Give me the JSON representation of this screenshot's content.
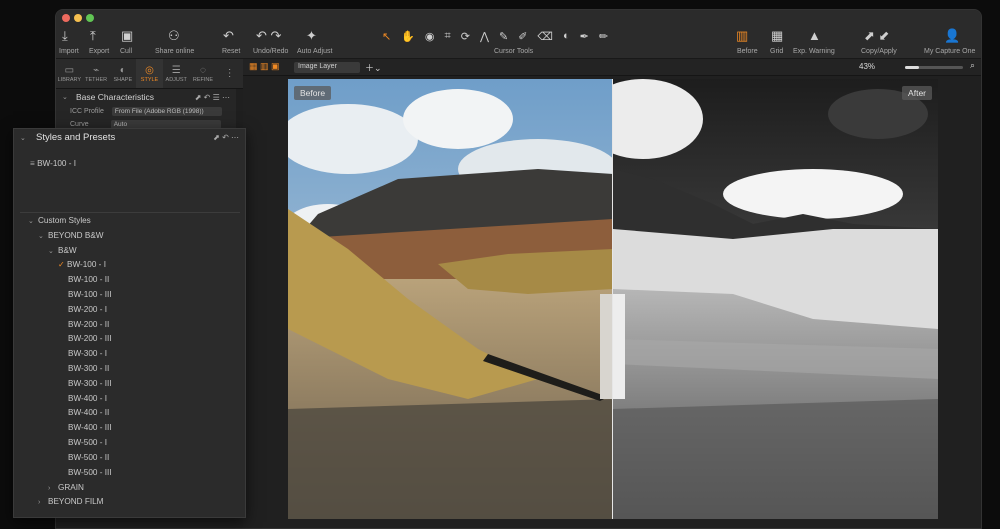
{
  "toolbar": {
    "buttons": [
      {
        "label": "Import",
        "icon": "import-icon"
      },
      {
        "label": "Export",
        "icon": "export-icon"
      },
      {
        "label": "Cull",
        "icon": "cull-icon"
      },
      {
        "label": "Share online",
        "icon": "share-online-icon"
      },
      {
        "label": "Reset",
        "icon": "reset-icon"
      },
      {
        "label": "Undo/Redo",
        "icon": "undo-redo-icon"
      },
      {
        "label": "Auto Adjust",
        "icon": "auto-adjust-icon"
      },
      {
        "label": "Before",
        "icon": "before-icon"
      },
      {
        "label": "Grid",
        "icon": "grid-icon"
      },
      {
        "label": "Exp. Warning",
        "icon": "exposure-warning-icon"
      },
      {
        "label": "Copy/Apply",
        "icon": "copy-apply-icon"
      },
      {
        "label": "My Capture One",
        "icon": "account-icon"
      }
    ],
    "cursor_tools_label": "Cursor Tools"
  },
  "tool_tabs": [
    {
      "label": "LIBRARY",
      "icon": "library-icon"
    },
    {
      "label": "TETHER",
      "icon": "tether-icon"
    },
    {
      "label": "SHAPE",
      "icon": "shape-icon"
    },
    {
      "label": "STYLE",
      "icon": "style-icon",
      "active": true
    },
    {
      "label": "ADJUST",
      "icon": "adjust-icon"
    },
    {
      "label": "REFINE",
      "icon": "refine-icon"
    }
  ],
  "base_characteristics": {
    "title": "Base Characteristics",
    "icc_label": "ICC Profile",
    "icc_value": "From File (Adobe RGB (1998))",
    "curve_label": "Curve",
    "curve_value": "Auto"
  },
  "viewer": {
    "layer_select": "Image Layer",
    "zoom": "43%",
    "before_label": "Before",
    "after_label": "After"
  },
  "styles_panel": {
    "title": "Styles and Presets",
    "applied": "BW-100 - I",
    "custom_styles": "Custom Styles",
    "beyond_bw": "BEYOND B&W",
    "bw_folder": "B&W",
    "styles": [
      "BW-100 - I",
      "BW-100 - II",
      "BW-100 - III",
      "BW-200 - I",
      "BW-200 - II",
      "BW-200 - III",
      "BW-300 - I",
      "BW-300 - II",
      "BW-300 - III",
      "BW-400 - I",
      "BW-400 - II",
      "BW-400 - III",
      "BW-500 - I",
      "BW-500 - II",
      "BW-500 - III"
    ],
    "grain": "GRAIN",
    "beyond_film": "BEYOND FILM"
  },
  "colors": {
    "accent": "#f08a24"
  }
}
